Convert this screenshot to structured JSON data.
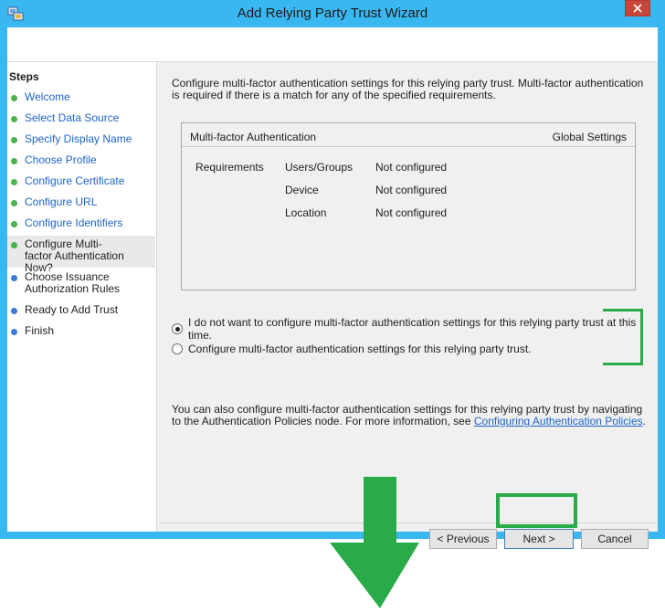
{
  "window": {
    "title": "Add Relying Party Trust Wizard"
  },
  "steps": {
    "title": "Steps",
    "items": [
      {
        "label": "Welcome",
        "status": "done"
      },
      {
        "label": "Select Data Source",
        "status": "done"
      },
      {
        "label": "Specify Display Name",
        "status": "done"
      },
      {
        "label": "Choose Profile",
        "status": "done"
      },
      {
        "label": "Configure Certificate",
        "status": "done"
      },
      {
        "label": "Configure URL",
        "status": "done"
      },
      {
        "label": "Configure Identifiers",
        "status": "done"
      },
      {
        "label": "Configure Multi-factor Authentication Now?",
        "status": "current"
      },
      {
        "label": "Choose Issuance Authorization Rules",
        "status": "pending"
      },
      {
        "label": "Ready to Add Trust",
        "status": "pending"
      },
      {
        "label": "Finish",
        "status": "pending"
      }
    ]
  },
  "content": {
    "intro": "Configure multi-factor authentication settings for this relying party trust. Multi-factor authentication is required if there is a match for any of the specified requirements.",
    "mfa_box": {
      "header_left": "Multi-factor Authentication",
      "header_right": "Global Settings",
      "requirements_label": "Requirements",
      "rows": [
        {
          "key": "Users/Groups",
          "value": "Not configured"
        },
        {
          "key": "Device",
          "value": "Not configured"
        },
        {
          "key": "Location",
          "value": "Not configured"
        }
      ]
    },
    "options": [
      {
        "label": "I do not want to configure multi-factor authentication settings for this relying party trust at this time.",
        "selected": true
      },
      {
        "label": "Configure multi-factor authentication settings for this relying party trust.",
        "selected": false
      }
    ],
    "more_info_text": "You can also configure multi-factor authentication settings for this relying party trust by navigating to the Authentication Policies node. For more information, see ",
    "more_info_link": "Configuring Authentication Policies",
    "more_info_end": "."
  },
  "buttons": {
    "previous": "< Previous",
    "next": "Next >",
    "cancel": "Cancel"
  },
  "colors": {
    "title_bar": "#39b7f0",
    "highlight": "#2aab4a",
    "done_dot": "#4bb34b",
    "pending_dot": "#3a7cd6",
    "link": "#1e64c8"
  }
}
